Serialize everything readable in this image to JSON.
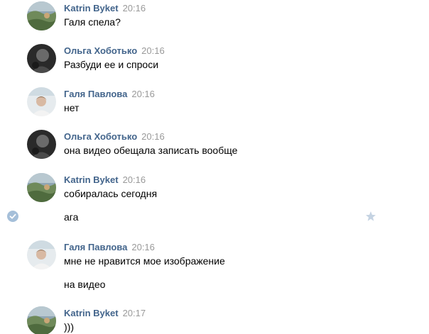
{
  "messages": [
    {
      "author": "Katrin Byket",
      "time": "20:16",
      "lines": [
        "Галя спела?"
      ],
      "avatar": "landscape"
    },
    {
      "author": "Ольга Хоботько",
      "time": "20:16",
      "lines": [
        "Разбуди ее и спроси"
      ],
      "avatar": "dark"
    },
    {
      "author": "Галя Павлова",
      "time": "20:16",
      "lines": [
        "нет"
      ],
      "avatar": "light"
    },
    {
      "author": "Ольга Хоботько",
      "time": "20:16",
      "lines": [
        "она видео обещала записать вообще"
      ],
      "avatar": "dark"
    },
    {
      "author": "Katrin Byket",
      "time": "20:16",
      "lines": [
        "собиралась сегодня",
        "ага"
      ],
      "avatar": "landscape"
    },
    {
      "author": "Галя Павлова",
      "time": "20:16",
      "lines": [
        "мне не нравится мое изображение",
        "на видео"
      ],
      "avatar": "light"
    },
    {
      "author": "Katrin Byket",
      "time": "20:17",
      "lines": [
        ")))"
      ],
      "avatar": "landscape"
    }
  ],
  "colors": {
    "author_name": "#42648b",
    "timestamp": "#999999",
    "check_icon": "#a5bfd9",
    "star_icon": "#c5d3e2"
  },
  "icons": {
    "selected": "check-circle-icon",
    "favorite": "star-icon"
  }
}
